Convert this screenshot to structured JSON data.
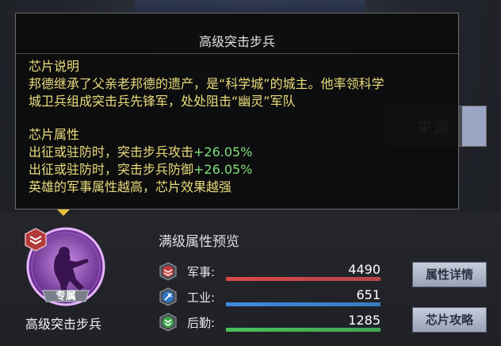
{
  "tooltip": {
    "title": "高级突击步兵",
    "desc_heading": "芯片说明",
    "desc_line1": "邦德继承了父亲老邦德的遗产，是“科学城”的城主。他率领科学",
    "desc_line2": "城卫兵组成突击兵先锋军，处处阻击“幽灵”军队",
    "attr_heading": "芯片属性",
    "attr1_text": "出征或驻防时，突击步兵攻击",
    "attr1_value": "+26.05%",
    "attr2_text": "出征或驻防时，突击步兵防御",
    "attr2_value": "+26.05%",
    "attr_note": "英雄的军事属性越高，芯片效果越强"
  },
  "background": {
    "source_button_label": "来源"
  },
  "unit": {
    "exclusive_tag": "专属",
    "name": "高级突击步兵"
  },
  "preview": {
    "title": "满级属性预览",
    "stats": [
      {
        "label": "军事:",
        "value": "4490",
        "icon": "military-icon",
        "color": "#d94a4a",
        "fill_fraction": 1.0
      },
      {
        "label": "工业:",
        "value": "651",
        "icon": "industry-icon",
        "color": "#3d8be0",
        "fill_fraction": 1.0
      },
      {
        "label": "后勤:",
        "value": "1285",
        "icon": "logistics-icon",
        "color": "#49c25a",
        "fill_fraction": 1.0
      }
    ]
  },
  "buttons": {
    "details_label": "属性详情",
    "guide_label": "芯片攻略"
  }
}
